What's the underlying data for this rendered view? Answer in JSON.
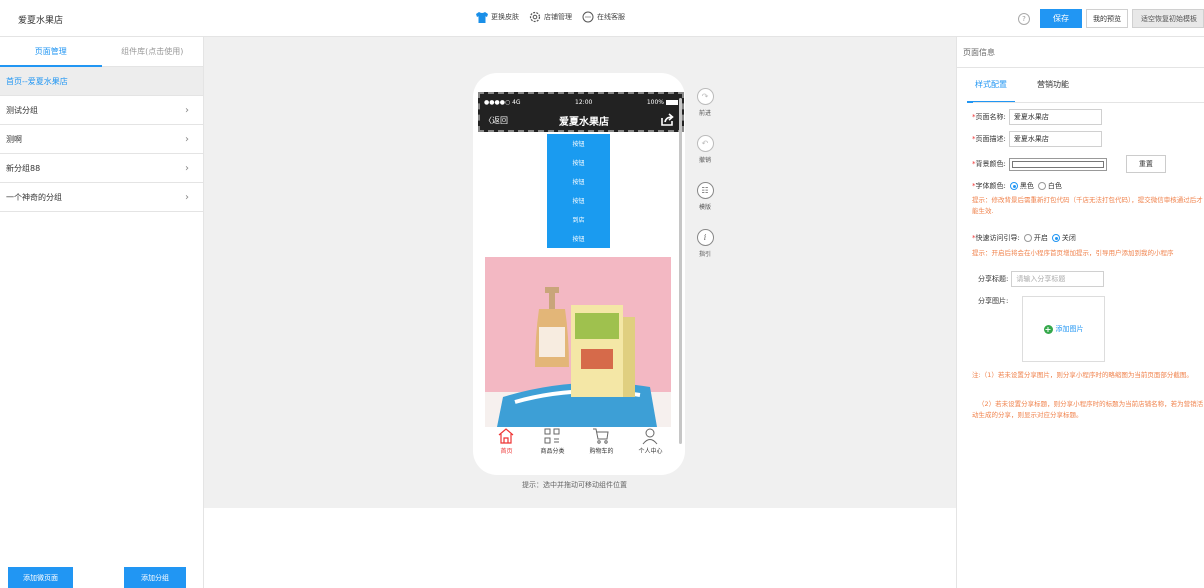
{
  "header": {
    "shop_name": "爱夏水果店",
    "links": [
      {
        "label": "更换皮肤",
        "icon": "shirt-icon"
      },
      {
        "label": "店铺管理",
        "icon": "gear-icon"
      },
      {
        "label": "在线客服",
        "icon": "chat-icon"
      }
    ],
    "help": "?",
    "save": "保存",
    "preview": "我的预览",
    "reset_template": "适空恢复初始模板"
  },
  "sidebar": {
    "tabs": [
      "页面管理",
      "组件库(点击使用)"
    ],
    "home_page": "首页--爱夏水果店",
    "groups": [
      "测试分组",
      "测啊",
      "新分组88",
      "一个神奇的分组"
    ],
    "add_page": "添加微页面",
    "add_group": "添加分组"
  },
  "phone": {
    "signal": "●●●●○ 4G",
    "time": "12:00",
    "battery": "100%",
    "back": "〈返回",
    "title": "爱夏水果店",
    "stack_buttons": [
      "按钮",
      "按钮",
      "按钮",
      "按钮",
      "到店",
      "按钮"
    ],
    "tabbar": [
      {
        "label": "首页",
        "active": true
      },
      {
        "label": "商品分类",
        "active": false
      },
      {
        "label": "购物车的",
        "active": false
      },
      {
        "label": "个人中心",
        "active": false
      }
    ],
    "hint": "提示：选中并拖动可移动组件位置"
  },
  "tools": [
    {
      "label": "前进",
      "icon": "redo-icon"
    },
    {
      "label": "撤销",
      "icon": "undo-icon"
    },
    {
      "label": "模版",
      "icon": "template-icon"
    },
    {
      "label": "指引",
      "icon": "info-icon"
    }
  ],
  "rpanel": {
    "head": "页面信息",
    "tabs": [
      "样式配置",
      "营销功能"
    ],
    "page_name_label": "页面名称:",
    "page_name_value": "爱夏水果店",
    "page_desc_label": "页面描述:",
    "page_desc_value": "爱夏水果店",
    "bg_color_label": "背景颜色:",
    "reset": "重置",
    "font_color_label": "字体颜色:",
    "font_black": "黑色",
    "font_white": "白色",
    "tip1": "提示：修改背景后需重新打包代码（千店无法打包代码），提交微信审核通过后才能生效.",
    "quick_access_label": "快速访问引导:",
    "open": "开启",
    "close": "关闭",
    "tip2": "提示：开启后将会在小程序首页增加提示，引导用户添加到我的小程序",
    "share_title_label": "分享标题:",
    "share_title_ph": "请输入分享标题",
    "share_img_label": "分享图片:",
    "add_image": "添加图片",
    "note1": "注:（1）若未设置分享图片，则分享小程序时的略缩图为当前页面部分截图。",
    "note2": "（2）若未设置分享标题，则分享小程序时的标题为当前店铺名称，若为营销活动生成的分享，则显示对应分享标题。"
  }
}
